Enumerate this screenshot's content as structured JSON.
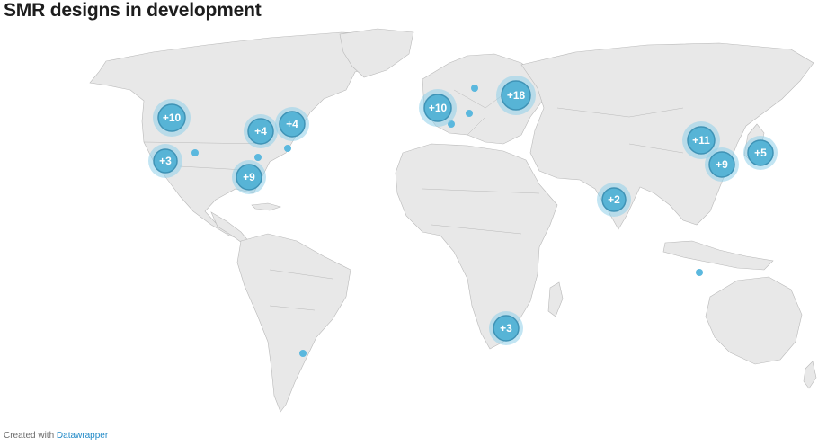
{
  "title": "SMR designs in development",
  "footer": {
    "prefix": "Created with",
    "link": "Datawrapper"
  },
  "colors": {
    "land": "#e8e8e8",
    "border": "#b9b9b9",
    "marker": "#57b4d6",
    "halo": "#8fd0ea",
    "dot": "#5bb8de"
  },
  "clusters": [
    {
      "id": "us-northwest",
      "label": "+10"
    },
    {
      "id": "us-west",
      "label": "+3"
    },
    {
      "id": "us-midwest",
      "label": "+4"
    },
    {
      "id": "us-northeast",
      "label": "+4"
    },
    {
      "id": "us-southeast",
      "label": "+9"
    },
    {
      "id": "western-europe",
      "label": "+10"
    },
    {
      "id": "russia",
      "label": "+18"
    },
    {
      "id": "china",
      "label": "+11"
    },
    {
      "id": "east-china",
      "label": "+9"
    },
    {
      "id": "japan",
      "label": "+5"
    },
    {
      "id": "india",
      "label": "+2"
    },
    {
      "id": "south-africa",
      "label": "+3"
    }
  ]
}
